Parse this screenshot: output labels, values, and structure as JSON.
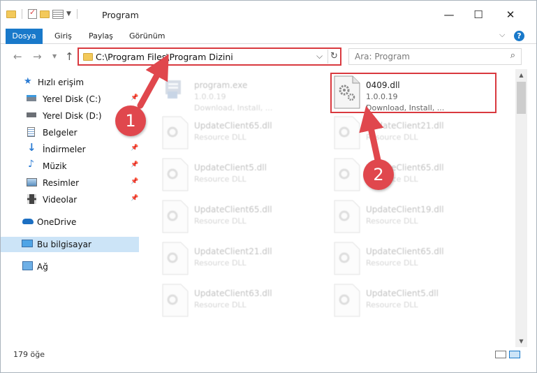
{
  "title": "Program",
  "ribbon": {
    "file": "Dosya",
    "home": "Giriş",
    "share": "Paylaş",
    "view": "Görünüm"
  },
  "address": {
    "path": "C:\\Program Files\\Program Dizini"
  },
  "search": {
    "placeholder": "Ara: Program"
  },
  "sidebar": {
    "quick_access": "Hızlı erişim",
    "items": [
      {
        "label": "Yerel Disk (C:)"
      },
      {
        "label": "Yerel Disk (D:)"
      },
      {
        "label": "Belgeler"
      },
      {
        "label": "İndirmeler"
      },
      {
        "label": "Müzik"
      },
      {
        "label": "Resimler"
      },
      {
        "label": "Videolar"
      }
    ],
    "onedrive": "OneDrive",
    "this_pc": "Bu bilgisayar",
    "network": "Ağ"
  },
  "files": [
    {
      "name": "program.exe",
      "version": "1.0.0.19",
      "desc": "Download, Install, ..."
    },
    {
      "name": "0409.dll",
      "version": "1.0.0.19",
      "desc": "Download, Install, ..."
    },
    {
      "name": "UpdateClient65.dll",
      "desc": "Resource DLL"
    },
    {
      "name": "UpdateClient21.dll",
      "desc": "Resource DLL"
    },
    {
      "name": "UpdateClient5.dll",
      "desc": "Resource DLL"
    },
    {
      "name": "UpdateClient65.dll",
      "desc": "Resource DLL"
    },
    {
      "name": "UpdateClient65.dll",
      "desc": "Resource DLL"
    },
    {
      "name": "UpdateClient19.dll",
      "desc": "Resource DLL"
    },
    {
      "name": "UpdateClient21.dll",
      "desc": "Resource DLL"
    },
    {
      "name": "UpdateClient65.dll",
      "desc": "Resource DLL"
    },
    {
      "name": "UpdateClient63.dll",
      "desc": "Resource DLL"
    },
    {
      "name": "UpdateClient5.dll",
      "desc": "Resource DLL"
    }
  ],
  "status": {
    "count": "179 öğe"
  },
  "annotations": {
    "marker1": "1",
    "marker2": "2"
  },
  "colors": {
    "accent": "#1979ca",
    "highlight": "#d9393f",
    "marker": "#e0474d"
  }
}
